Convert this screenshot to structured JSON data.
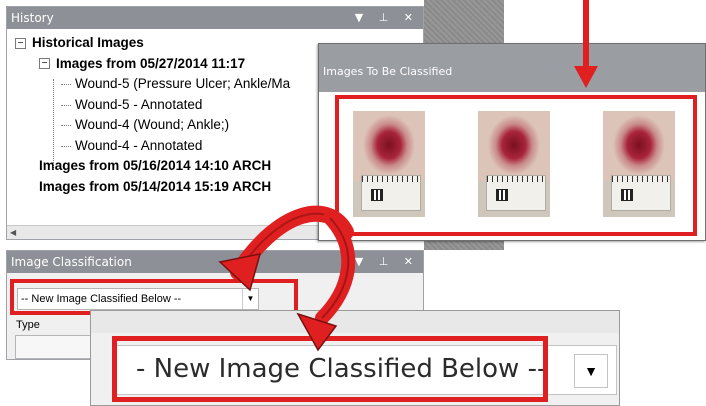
{
  "history": {
    "title": "History",
    "controls": "▼ ⊥ ✕",
    "tree": {
      "root": "Historical Images",
      "group1": "Images from 05/27/2014 11:17",
      "items": [
        "Wound-5 (Pressure Ulcer; Ankle/Ma",
        "Wound-5 - Annotated",
        "Wound-4 (Wound; Ankle;)",
        "Wound-4 - Annotated"
      ],
      "group2": "Images from 05/16/2014 14:10 ARCH",
      "group3": "Images from 05/14/2014 15:19 ARCH"
    },
    "expand_minus": "−"
  },
  "classification": {
    "title": "Image Classification",
    "controls": "▼ ⊥ ✕",
    "dropdown_value": "-- New Image Classified Below --",
    "type_label": "Type"
  },
  "to_classify": {
    "title": "Images To Be Classified",
    "thumbnails": [
      "wound-photo",
      "wound-photo",
      "wound-photo"
    ]
  },
  "zoom": {
    "dropdown_value": "- New Image Classified Below --",
    "dropdown_arrow": "▼"
  },
  "colors": {
    "highlight": "#e02020",
    "pane_title": "#8d9096"
  }
}
